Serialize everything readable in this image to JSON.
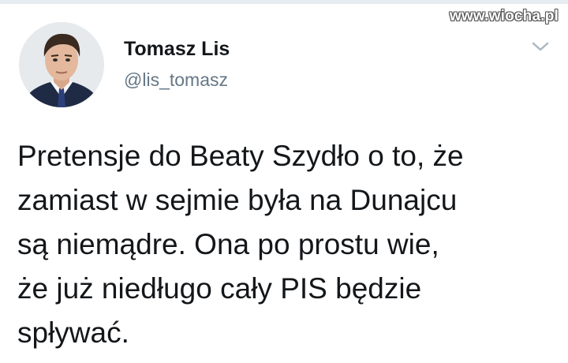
{
  "watermark": "www.wiocha.pl",
  "author": {
    "name": "Tomasz Lis",
    "handle": "@lis_tomasz",
    "avatar_icon": "profile-photo"
  },
  "menu_icon": "chevron-down-icon",
  "tweet": {
    "text": "Pretensje do Beaty Szydło o to, że\nzamiast w sejmie była na Dunajcu\nsą niemądre. Ona po prostu wie,\nże już niedługo cały PIS będzie\nspływać."
  },
  "colors": {
    "text": "#14171a",
    "secondary": "#657786",
    "chevron": "#aab8c2"
  }
}
